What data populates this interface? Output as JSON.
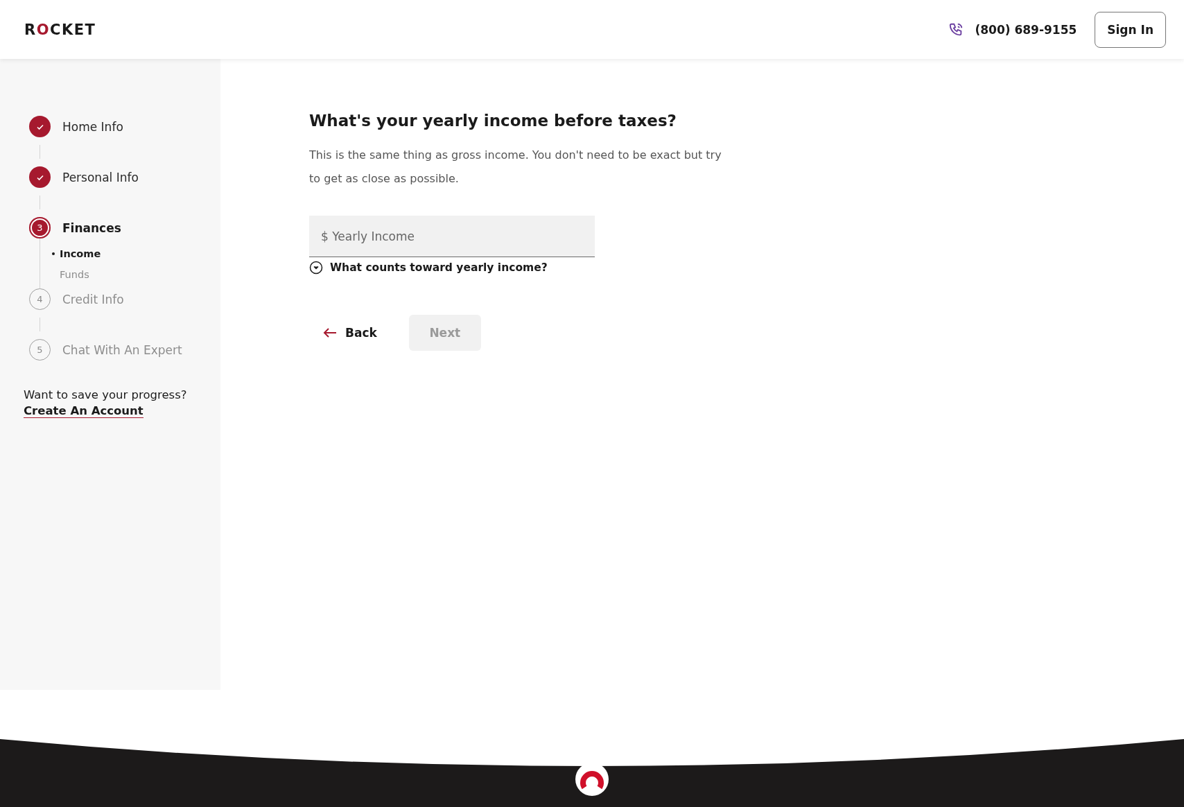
{
  "header": {
    "logo": "ROCKET",
    "phone": "(800) 689-9155",
    "sign_in": "Sign In"
  },
  "sidebar": {
    "steps": [
      {
        "label": "Home Info",
        "completed": true,
        "selected": false
      },
      {
        "label": "Personal Info",
        "completed": true,
        "selected": false
      },
      {
        "number": "3",
        "label": "Finances",
        "completed": false,
        "selected": true,
        "children": [
          {
            "label": "Income",
            "selected": true
          },
          {
            "label": "Funds",
            "selected": false
          }
        ]
      },
      {
        "number": "4",
        "label": "Credit Info",
        "completed": false,
        "selected": false
      },
      {
        "number": "5",
        "label": "Chat With An Expert",
        "completed": false,
        "selected": false
      }
    ],
    "save_prompt": "Want to save your progress?",
    "create_account": "Create An Account"
  },
  "main": {
    "title": "What's your yearly income before taxes?",
    "description": "This is the same thing as gross income. You don't need to be exact but try to get as close as possible.",
    "income_field": {
      "placeholder": "$ Yearly Income"
    },
    "help_toggle": {
      "label": "What counts toward yearly income?",
      "expanded": false
    },
    "back": "Back",
    "next": {
      "label": "Next",
      "disabled": true
    }
  }
}
